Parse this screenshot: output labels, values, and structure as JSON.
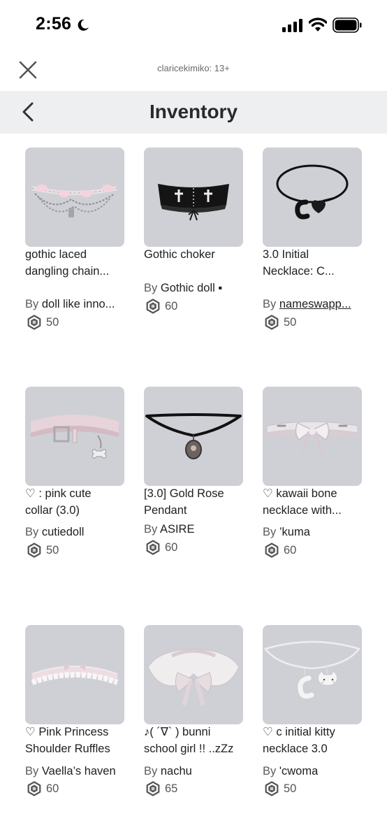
{
  "status_bar": {
    "time": "2:56"
  },
  "header": {
    "account": "claricekimiko: 13+",
    "title": "Inventory"
  },
  "icons": {
    "close": "close-icon",
    "back": "chevron-left-icon",
    "currency": "robux-icon",
    "moon": "moon-icon",
    "signal": "signal-icon",
    "wifi": "wifi-icon",
    "battery": "battery-icon"
  },
  "items": [
    {
      "name": [
        "gothic laced",
        "dangling chain..."
      ],
      "by": "By",
      "creator": "doll like inno...",
      "price": "50"
    },
    {
      "name": [
        "Gothic choker"
      ],
      "by": "By",
      "creator": "Gothic doll ▪",
      "price": "60"
    },
    {
      "name": [
        "3.0 Initial",
        "Necklace: C..."
      ],
      "by": "By",
      "creator": "nameswapp...",
      "price": "50"
    },
    {
      "name": [
        "♡ : pink cute",
        "collar (3.0)"
      ],
      "by": "By",
      "creator": "cutiedoll",
      "price": "50"
    },
    {
      "name": [
        "[3.0] Gold Rose",
        "Pendant"
      ],
      "by": "By",
      "creator": "ASIRE",
      "price": "60"
    },
    {
      "name": [
        "♡ kawaii bone",
        "necklace with..."
      ],
      "by": "By",
      "creator": "’kuma",
      "price": "60"
    },
    {
      "name": [
        "♡ Pink Princess",
        "Shoulder Ruffles"
      ],
      "by": "By",
      "creator": "Vaella’s haven",
      "price": "60"
    },
    {
      "name": [
        "♪( ´∇` ) bunni",
        "school girl !! ..zZz"
      ],
      "by": "By",
      "creator": "nachu",
      "price": "65"
    },
    {
      "name": [
        "♡ c initial kitty",
        "necklace 3.0"
      ],
      "by": "By",
      "creator": "'cwoma",
      "price": "50"
    }
  ],
  "colors": {
    "thumb_bg": "#cfd0d6",
    "nav_bg": "#eeeff1",
    "text": "#202020",
    "muted": "#5c5c5c"
  }
}
